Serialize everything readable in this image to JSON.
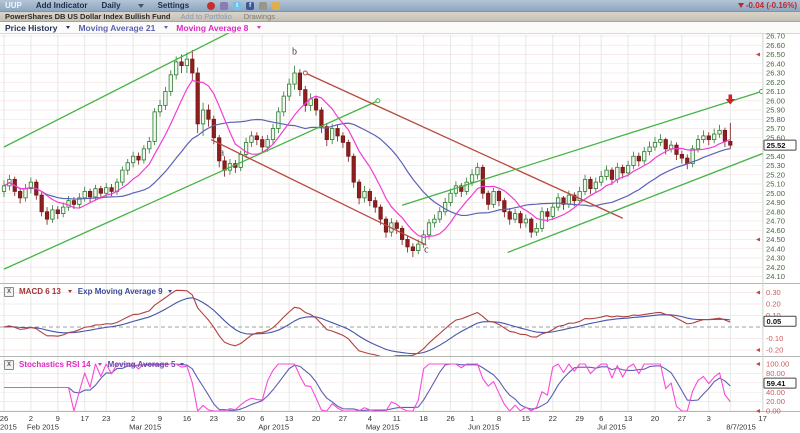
{
  "toolbar": {
    "symbol": "UUP",
    "add_indicator": "Add Indicator",
    "period": "Daily",
    "settings": "Settings",
    "icons": [
      {
        "name": "alert-icon",
        "color": "#c43030",
        "shape": "circle"
      },
      {
        "name": "cube-icon",
        "color": "#8a7ab8",
        "shape": "square"
      },
      {
        "name": "twitter-icon",
        "color": "#6fc2ea",
        "shape": "square",
        "letter": "t"
      },
      {
        "name": "facebook-icon",
        "color": "#3b5998",
        "shape": "square",
        "letter": "f"
      },
      {
        "name": "camera-icon",
        "color": "#9a958a",
        "shape": "square"
      },
      {
        "name": "notes-icon",
        "color": "#e0ae4a",
        "shape": "square"
      }
    ],
    "change": "-0.04 (-0.16%)"
  },
  "subheader": {
    "fund_name": "PowerShares DB US Dollar Index Bullish Fund",
    "add_to_portfolio": "Add to Portfolio",
    "drawings": "Drawings"
  },
  "indicator_bar": {
    "price_history": "Price History",
    "ma21": "Moving Average 21",
    "ma8": "Moving Average 8"
  },
  "panels": {
    "macd": {
      "close_glyph": "X",
      "label": "MACD 6 13",
      "signal_label": "Exp Moving Average 9",
      "axis_labels": [
        "0.30",
        "0.20",
        "0.10",
        "-0.10",
        "-0.20"
      ],
      "axis_values": [
        0.3,
        0.2,
        0.1,
        -0.1,
        -0.2
      ],
      "grid_values": [
        0.3,
        0.2,
        0.1,
        -0.1,
        -0.2
      ],
      "current": "0.05",
      "current_value": 0.05
    },
    "stoch": {
      "close_glyph": "X",
      "label": "Stochastics RSI 14",
      "signal_label": "Moving Average 5",
      "axis_labels": [
        "100.00",
        "80.00",
        "40.00",
        "20.00",
        "0.00"
      ],
      "axis_values": [
        100,
        80,
        40,
        20,
        0
      ],
      "grid_values": [
        0,
        20,
        40,
        60,
        80,
        100
      ],
      "current": "59.41",
      "current_value": 59.41
    }
  },
  "price_axis": {
    "max": 26.7,
    "min": 24.1,
    "step": 0.1,
    "labels": [
      "26.70",
      "26.60",
      "26.50",
      "26.40",
      "26.30",
      "26.20",
      "26.10",
      "26.00",
      "25.90",
      "25.80",
      "25.70",
      "25.60",
      "25.40",
      "25.30",
      "25.20",
      "25.10",
      "25.00",
      "24.90",
      "24.80",
      "24.70",
      "24.60",
      "24.50",
      "24.40",
      "24.30",
      "24.20",
      "24.10"
    ],
    "current": "25.52",
    "current_value": 25.52
  },
  "axis_markers": {
    "main": [
      26.5,
      24.5
    ],
    "macd": [
      0.3,
      -0.2
    ],
    "stoch": [
      100,
      0
    ]
  },
  "x_axis": {
    "ticks": [
      {
        "i": 0,
        "day": "26",
        "month": "2015"
      },
      {
        "i": 5,
        "day": "2",
        "month": "Feb 2015"
      },
      {
        "i": 10,
        "day": "9"
      },
      {
        "i": 15,
        "day": "17"
      },
      {
        "i": 19,
        "day": "23"
      },
      {
        "i": 24,
        "day": "2",
        "month": "Mar 2015"
      },
      {
        "i": 29,
        "day": "9"
      },
      {
        "i": 34,
        "day": "16"
      },
      {
        "i": 39,
        "day": "23"
      },
      {
        "i": 44,
        "day": "30"
      },
      {
        "i": 48,
        "day": "6",
        "month": "Apr 2015"
      },
      {
        "i": 53,
        "day": "13"
      },
      {
        "i": 58,
        "day": "20"
      },
      {
        "i": 63,
        "day": "27"
      },
      {
        "i": 68,
        "day": "4",
        "month": "May 2015"
      },
      {
        "i": 73,
        "day": "11"
      },
      {
        "i": 78,
        "day": "18"
      },
      {
        "i": 83,
        "day": "26"
      },
      {
        "i": 87,
        "day": "1",
        "month": "Jun 2015"
      },
      {
        "i": 92,
        "day": "8"
      },
      {
        "i": 97,
        "day": "15"
      },
      {
        "i": 102,
        "day": "22"
      },
      {
        "i": 107,
        "day": "29"
      },
      {
        "i": 111,
        "day": "6",
        "month": "Jul 2015"
      },
      {
        "i": 116,
        "day": "13"
      },
      {
        "i": 121,
        "day": "20"
      },
      {
        "i": 126,
        "day": "27"
      },
      {
        "i": 131,
        "day": "3"
      },
      {
        "i": 135,
        "month": "8/7/2015"
      },
      {
        "i": 141,
        "day": "17"
      }
    ]
  },
  "chart_data": {
    "type": "candlestick",
    "title": "UUP - PowerShares DB US Dollar Index Bullish Fund, Daily",
    "ylim": [
      24.1,
      26.7
    ],
    "last_close": 25.52,
    "change": -0.04,
    "change_pct": -0.16,
    "indicators": [
      {
        "name": "Moving Average 8",
        "color": "#f23cd4"
      },
      {
        "name": "Moving Average 21",
        "color": "#5c63b5"
      },
      {
        "name": "MACD 6 13",
        "color": "#b14040",
        "signal": "Exp Moving Average 9",
        "signal_color": "#4356a8",
        "last": 0.05
      },
      {
        "name": "Stochastics RSI 14",
        "color": "#f84ad9",
        "signal": "Moving Average 5",
        "signal_color": "#5c5fb0",
        "last": 59.41
      }
    ],
    "candles": [
      [
        25.02,
        25.14,
        24.96,
        25.08
      ],
      [
        25.08,
        25.2,
        25.03,
        25.15
      ],
      [
        25.15,
        25.18,
        24.97,
        25.02
      ],
      [
        25.02,
        25.06,
        24.89,
        24.95
      ],
      [
        24.95,
        25.1,
        24.91,
        25.05
      ],
      [
        25.05,
        25.17,
        25.0,
        25.12
      ],
      [
        25.12,
        25.15,
        24.93,
        24.98
      ],
      [
        24.98,
        25.01,
        24.75,
        24.8
      ],
      [
        24.8,
        24.85,
        24.66,
        24.72
      ],
      [
        24.72,
        24.87,
        24.68,
        24.82
      ],
      [
        24.82,
        24.86,
        24.72,
        24.78
      ],
      [
        24.78,
        24.9,
        24.74,
        24.85
      ],
      [
        24.85,
        24.97,
        24.81,
        24.92
      ],
      [
        24.92,
        24.96,
        24.83,
        24.88
      ],
      [
        24.88,
        25.0,
        24.84,
        24.95
      ],
      [
        24.95,
        25.07,
        24.91,
        25.02
      ],
      [
        25.02,
        25.05,
        24.9,
        24.96
      ],
      [
        24.96,
        25.09,
        24.92,
        25.05
      ],
      [
        25.05,
        25.08,
        24.94,
        25.0
      ],
      [
        25.0,
        25.11,
        24.96,
        25.06
      ],
      [
        25.06,
        25.1,
        24.97,
        25.02
      ],
      [
        25.02,
        25.16,
        24.98,
        25.12
      ],
      [
        25.12,
        25.29,
        25.08,
        25.25
      ],
      [
        25.25,
        25.37,
        25.2,
        25.33
      ],
      [
        25.33,
        25.45,
        25.28,
        25.4
      ],
      [
        25.4,
        25.44,
        25.31,
        25.36
      ],
      [
        25.36,
        25.52,
        25.32,
        25.48
      ],
      [
        25.48,
        25.61,
        25.43,
        25.56
      ],
      [
        25.56,
        25.92,
        25.52,
        25.88
      ],
      [
        25.88,
        26.01,
        25.83,
        25.95
      ],
      [
        25.95,
        26.15,
        25.9,
        26.1
      ],
      [
        26.1,
        26.33,
        26.05,
        26.28
      ],
      [
        26.28,
        26.48,
        26.23,
        26.42
      ],
      [
        26.42,
        26.5,
        26.3,
        26.38
      ],
      [
        26.38,
        26.52,
        26.3,
        26.45
      ],
      [
        26.45,
        26.55,
        26.22,
        26.3
      ],
      [
        26.3,
        26.36,
        25.65,
        25.75
      ],
      [
        25.75,
        25.98,
        25.62,
        25.9
      ],
      [
        25.9,
        25.96,
        25.72,
        25.8
      ],
      [
        25.8,
        25.84,
        25.53,
        25.6
      ],
      [
        25.6,
        25.63,
        25.28,
        25.35
      ],
      [
        25.35,
        25.4,
        25.18,
        25.25
      ],
      [
        25.25,
        25.37,
        25.2,
        25.32
      ],
      [
        25.32,
        25.36,
        25.22,
        25.28
      ],
      [
        25.28,
        25.46,
        25.24,
        25.42
      ],
      [
        25.42,
        25.6,
        25.38,
        25.55
      ],
      [
        25.55,
        25.67,
        25.5,
        25.62
      ],
      [
        25.62,
        25.66,
        25.52,
        25.58
      ],
      [
        25.58,
        25.62,
        25.44,
        25.5
      ],
      [
        25.5,
        25.63,
        25.45,
        25.58
      ],
      [
        25.58,
        25.75,
        25.53,
        25.7
      ],
      [
        25.7,
        25.93,
        25.65,
        25.88
      ],
      [
        25.88,
        26.1,
        25.83,
        26.05
      ],
      [
        26.05,
        26.24,
        26.0,
        26.18
      ],
      [
        26.18,
        26.38,
        26.12,
        26.3
      ],
      [
        26.3,
        26.34,
        26.05,
        26.12
      ],
      [
        26.12,
        26.16,
        25.88,
        25.95
      ],
      [
        25.95,
        26.08,
        25.89,
        26.02
      ],
      [
        26.02,
        26.05,
        25.84,
        25.9
      ],
      [
        25.9,
        25.93,
        25.65,
        25.72
      ],
      [
        25.72,
        25.76,
        25.51,
        25.58
      ],
      [
        25.58,
        25.75,
        25.53,
        25.7
      ],
      [
        25.7,
        25.74,
        25.56,
        25.62
      ],
      [
        25.62,
        25.66,
        25.49,
        25.55
      ],
      [
        25.55,
        25.58,
        25.34,
        25.4
      ],
      [
        25.4,
        25.43,
        25.06,
        25.12
      ],
      [
        25.12,
        25.15,
        24.88,
        24.95
      ],
      [
        24.95,
        25.08,
        24.9,
        25.02
      ],
      [
        25.02,
        25.05,
        24.86,
        24.92
      ],
      [
        24.92,
        24.96,
        24.79,
        24.85
      ],
      [
        24.85,
        24.88,
        24.66,
        24.72
      ],
      [
        24.72,
        24.75,
        24.52,
        24.58
      ],
      [
        24.58,
        24.73,
        24.53,
        24.68
      ],
      [
        24.68,
        24.71,
        24.56,
        24.62
      ],
      [
        24.62,
        24.65,
        24.44,
        24.5
      ],
      [
        24.5,
        24.54,
        24.36,
        24.42
      ],
      [
        24.42,
        24.46,
        24.31,
        24.38
      ],
      [
        24.38,
        24.5,
        24.34,
        24.45
      ],
      [
        24.45,
        24.6,
        24.41,
        24.55
      ],
      [
        24.55,
        24.72,
        24.5,
        24.68
      ],
      [
        24.68,
        24.77,
        24.63,
        24.72
      ],
      [
        24.72,
        24.85,
        24.68,
        24.8
      ],
      [
        24.8,
        24.95,
        24.76,
        24.9
      ],
      [
        24.9,
        25.05,
        24.86,
        25.0
      ],
      [
        25.0,
        25.13,
        24.96,
        25.08
      ],
      [
        25.08,
        25.11,
        24.96,
        25.02
      ],
      [
        25.02,
        25.17,
        24.98,
        25.12
      ],
      [
        25.12,
        25.26,
        25.08,
        25.2
      ],
      [
        25.2,
        25.33,
        25.15,
        25.28
      ],
      [
        25.28,
        25.31,
        24.94,
        25.0
      ],
      [
        25.0,
        25.03,
        24.82,
        24.88
      ],
      [
        24.88,
        25.06,
        24.84,
        25.02
      ],
      [
        25.02,
        25.04,
        24.86,
        24.92
      ],
      [
        24.92,
        24.95,
        24.74,
        24.8
      ],
      [
        24.8,
        24.84,
        24.66,
        24.72
      ],
      [
        24.72,
        24.83,
        24.68,
        24.78
      ],
      [
        24.78,
        24.81,
        24.62,
        24.68
      ],
      [
        24.68,
        24.77,
        24.63,
        24.72
      ],
      [
        24.72,
        24.74,
        24.52,
        24.58
      ],
      [
        24.58,
        24.68,
        24.54,
        24.62
      ],
      [
        24.62,
        24.85,
        24.58,
        24.8
      ],
      [
        24.8,
        24.84,
        24.69,
        24.75
      ],
      [
        24.75,
        24.9,
        24.71,
        24.85
      ],
      [
        24.85,
        25.0,
        24.81,
        24.95
      ],
      [
        24.95,
        24.97,
        24.82,
        24.88
      ],
      [
        24.88,
        25.03,
        24.84,
        24.98
      ],
      [
        24.98,
        25.01,
        24.86,
        24.92
      ],
      [
        24.92,
        25.07,
        24.88,
        25.02
      ],
      [
        25.02,
        25.2,
        24.98,
        25.15
      ],
      [
        25.15,
        25.18,
        24.99,
        25.05
      ],
      [
        25.05,
        25.17,
        25.01,
        25.12
      ],
      [
        25.12,
        25.24,
        25.08,
        25.18
      ],
      [
        25.18,
        25.3,
        25.14,
        25.25
      ],
      [
        25.25,
        25.28,
        25.09,
        25.15
      ],
      [
        25.15,
        25.33,
        25.11,
        25.28
      ],
      [
        25.28,
        25.31,
        25.16,
        25.22
      ],
      [
        25.22,
        25.35,
        25.18,
        25.3
      ],
      [
        25.3,
        25.45,
        25.26,
        25.4
      ],
      [
        25.4,
        25.44,
        25.29,
        25.35
      ],
      [
        25.35,
        25.5,
        25.31,
        25.45
      ],
      [
        25.45,
        25.56,
        25.41,
        25.5
      ],
      [
        25.5,
        25.61,
        25.46,
        25.55
      ],
      [
        25.55,
        25.64,
        25.51,
        25.58
      ],
      [
        25.58,
        25.6,
        25.42,
        25.48
      ],
      [
        25.48,
        25.57,
        25.44,
        25.52
      ],
      [
        25.52,
        25.55,
        25.36,
        25.42
      ],
      [
        25.42,
        25.46,
        25.32,
        25.38
      ],
      [
        25.38,
        25.42,
        25.26,
        25.32
      ],
      [
        25.32,
        25.52,
        25.28,
        25.48
      ],
      [
        25.48,
        25.63,
        25.44,
        25.58
      ],
      [
        25.58,
        25.68,
        25.54,
        25.62
      ],
      [
        25.62,
        25.66,
        25.52,
        25.58
      ],
      [
        25.58,
        25.7,
        25.54,
        25.64
      ],
      [
        25.64,
        25.74,
        25.6,
        25.68
      ],
      [
        25.68,
        25.71,
        25.5,
        25.56
      ],
      [
        25.56,
        25.76,
        25.48,
        25.52
      ]
    ],
    "drawings": {
      "lines": [
        {
          "name": "trendline-green-left-upper",
          "i1": 0,
          "p1": 25.5,
          "i2": 44,
          "p2": 26.8,
          "color": "#46b446",
          "handles": []
        },
        {
          "name": "trendline-green-left-lower",
          "i1": 0,
          "p1": 24.18,
          "i2": 69.5,
          "p2": 26.0,
          "color": "#46b446",
          "handles": [
            "end"
          ]
        },
        {
          "name": "trendline-red-upper",
          "i1": 56,
          "p1": 26.3,
          "i2": 115,
          "p2": 24.73,
          "color": "#b74a3f",
          "handles": [
            "start"
          ]
        },
        {
          "name": "trendline-red-lower",
          "i1": 38.5,
          "p1": 25.58,
          "i2": 78.5,
          "p2": 24.44,
          "color": "#b74a3f",
          "handles": []
        },
        {
          "name": "trendline-green-right-upper",
          "i1": 74,
          "p1": 24.87,
          "i2": 140.8,
          "p2": 26.1,
          "color": "#46b446",
          "handles": [
            "end"
          ]
        },
        {
          "name": "trendline-green-right-lower",
          "i1": 93.6,
          "p1": 24.36,
          "i2": 142.8,
          "p2": 25.47,
          "color": "#46b446",
          "handles": [
            "end"
          ]
        }
      ],
      "labels": [
        {
          "name": "wave-label-a",
          "text": "a",
          "i": 40.5,
          "p": 25.41
        },
        {
          "name": "wave-label-b",
          "text": "b",
          "i": 54,
          "p": 26.5
        },
        {
          "name": "wave-label-c",
          "text": "c",
          "i": 78.5,
          "p": 24.36
        }
      ],
      "arrow_marker": {
        "name": "sell-arrow",
        "i": 135,
        "p": 25.97,
        "color": "#d42222"
      }
    },
    "colors": {
      "up_stroke": "#2a7a2e",
      "up_fill": "#eff7ef",
      "down_stroke": "#761717",
      "down_fill": "#8e1f1f",
      "ma8": "#f23cd4",
      "ma21": "#5c63b5",
      "macd": "#b14040",
      "macd_signal": "#4356a8",
      "stoch": "#f84ad9",
      "stoch_signal": "#5c5fb0",
      "grid_v": "#e4eae4",
      "grid_h": "#f6e4e4",
      "axis_main": "#47663f",
      "axis_sub": "#cc5c5c",
      "separator": "#b5b5b5",
      "zero_line": "#a0a0a0"
    }
  }
}
